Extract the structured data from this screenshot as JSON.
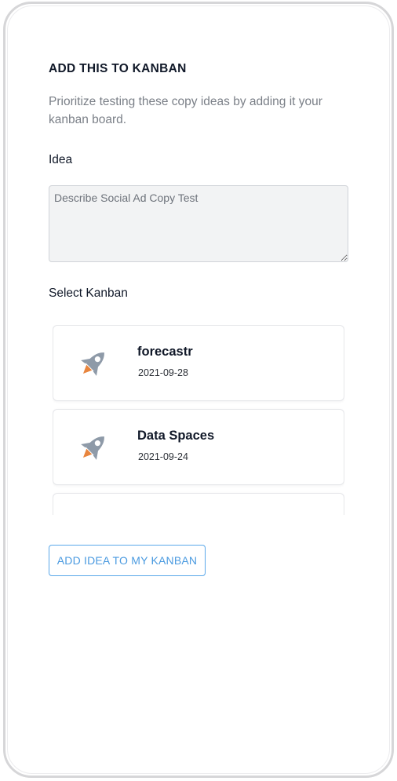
{
  "modal": {
    "title": "ADD THIS TO KANBAN",
    "description": "Prioritize testing these copy ideas by adding it your kanban board."
  },
  "idea": {
    "label": "Idea",
    "value": "",
    "placeholder": "Describe Social Ad Copy Test"
  },
  "kanban_select": {
    "label": "Select Kanban",
    "items": [
      {
        "name": "forecastr",
        "date": "2021-09-28",
        "icon": "rocket-icon"
      },
      {
        "name": "Data Spaces",
        "date": "2021-09-24",
        "icon": "rocket-icon"
      },
      {
        "name": "",
        "date": "",
        "icon": "rocket-icon"
      }
    ]
  },
  "actions": {
    "add_label": "ADD IDEA TO MY KANBAN"
  },
  "colors": {
    "accent": "#4a9ae0",
    "rocket_body": "#8e9aa8",
    "rocket_flame": "#e8853e",
    "heading": "#101828",
    "muted": "#7a7f87"
  }
}
